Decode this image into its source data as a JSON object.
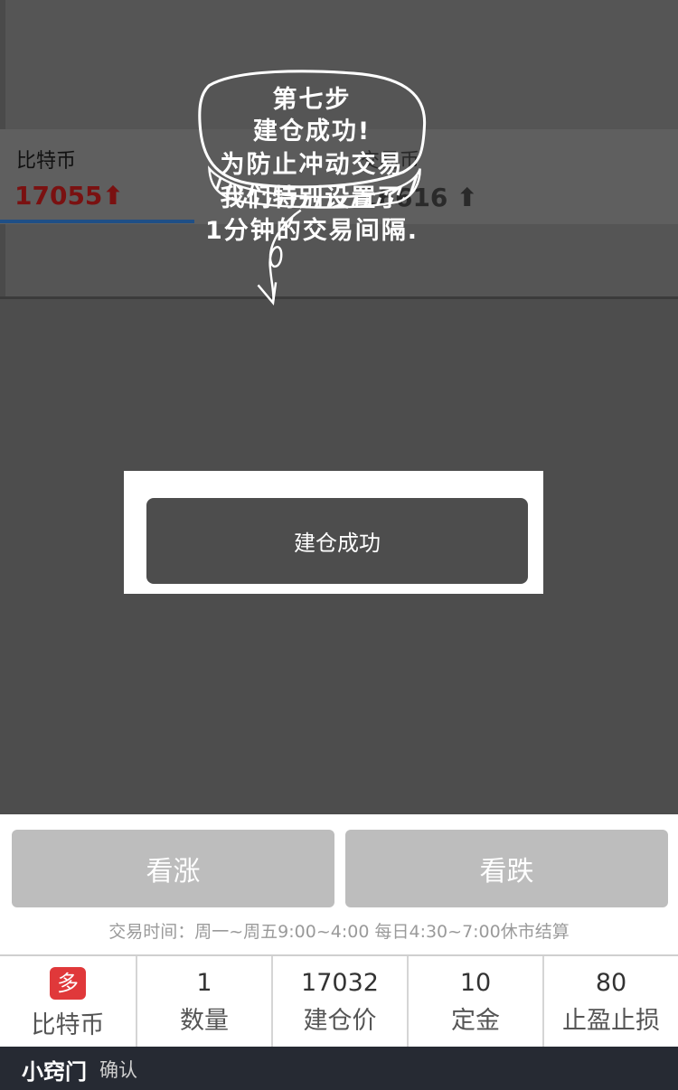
{
  "ticker": {
    "left_name": "比特币",
    "left_price": "17055",
    "left_arrow": "⬆",
    "left_price_color": "#7a1111",
    "right_name": "交易币",
    "right_price": "16616",
    "right_arrow": "⬆"
  },
  "callout": {
    "lines": [
      "第七步",
      "建仓成功!",
      "为防止冲动交易",
      "我们特别设置了",
      "1分钟的交易间隔."
    ]
  },
  "modal": {
    "message": "建仓成功"
  },
  "actions": {
    "rise_label": "看涨",
    "fall_label": "看跌"
  },
  "trade_time": "交易时间：周一~周五9:00~4:00 每日4:30~7:00休市结算",
  "position": {
    "direction_badge": "多",
    "asset": "比特币",
    "quantity_value": "1",
    "quantity_label": "数量",
    "open_price_value": "17032",
    "open_price_label": "建仓价",
    "deposit_value": "10",
    "deposit_label": "定金",
    "tp_sl_value": "80",
    "tp_sl_label": "止盈止损"
  },
  "footer": {
    "logo": "小窍门",
    "note": "确认"
  },
  "colors": {
    "badge": "#e0383a",
    "overlay": "#4d4d4d",
    "button_disabled": "#bdbdbd",
    "footer": "#262a33"
  }
}
